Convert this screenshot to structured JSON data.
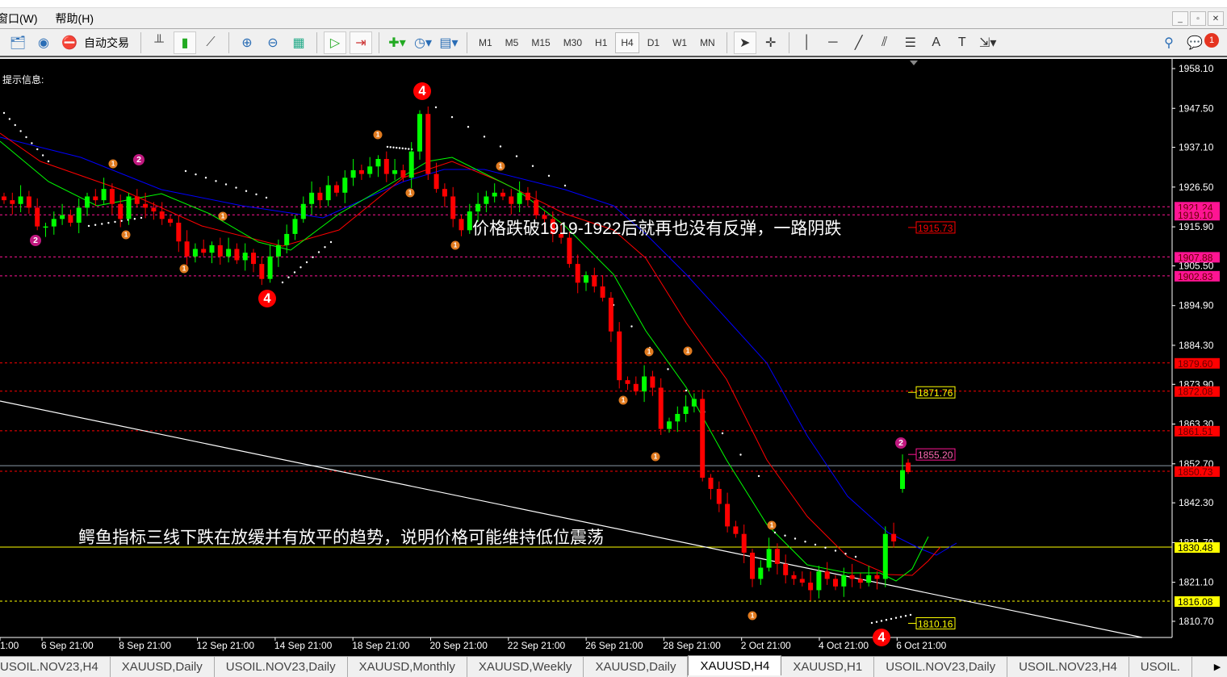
{
  "menu": [
    "窗口(W)",
    "帮助(H)"
  ],
  "window_controls": [
    "_",
    "▫",
    "✕"
  ],
  "toolbar": {
    "auto_trade_label": "自动交易",
    "timeframes": [
      "M1",
      "M5",
      "M15",
      "M30",
      "H1",
      "H4",
      "D1",
      "W1",
      "MN"
    ],
    "active_timeframe": "H4",
    "notification_count": "1"
  },
  "chart": {
    "hint_label": "提示信息:",
    "annotation_top": "价格跌破1919-1922后就再也没有反弹，一路阴跌",
    "annotation_bottom": "鳄鱼指标三线下跌在放缓并有放平的趋势，说明价格可能维持低位震荡",
    "price_axis": [
      "1958.10",
      "1947.50",
      "1937.10",
      "1926.50",
      "1915.90",
      "1905.50",
      "1894.90",
      "1884.30",
      "1873.90",
      "1863.30",
      "1852.70",
      "1842.30",
      "1831.70",
      "1821.10",
      "1810.70"
    ],
    "time_axis": [
      "1:00",
      "6 Sep 21:00",
      "8 Sep 21:00",
      "12 Sep 21:00",
      "14 Sep 21:00",
      "18 Sep 21:00",
      "20 Sep 21:00",
      "22 Sep 21:00",
      "26 Sep 21:00",
      "28 Sep 21:00",
      "2 Oct 21:00",
      "4 Oct 21:00",
      "6 Oct 21:00"
    ],
    "level_tags": [
      {
        "price": 1921.24,
        "label": "1921.24",
        "color": "#ff1493",
        "style": "dashed"
      },
      {
        "price": 1919.1,
        "label": "1919.10",
        "color": "#ff1493",
        "style": "dashed"
      },
      {
        "price": 1907.88,
        "label": "1907.88",
        "color": "#ff1493",
        "style": "dashed"
      },
      {
        "price": 1902.83,
        "label": "1902.83",
        "color": "#ff1493",
        "style": "dashed"
      },
      {
        "price": 1879.6,
        "label": "1879.60",
        "color": "#ff0000",
        "style": "dashed"
      },
      {
        "price": 1872.08,
        "label": "1872.08",
        "color": "#ff0000",
        "style": "dashed"
      },
      {
        "price": 1861.51,
        "label": "1861.51",
        "color": "#ff0000",
        "style": "dashed"
      },
      {
        "price": 1850.73,
        "label": "1850.73",
        "color": "#ff0000",
        "style": "dashed"
      },
      {
        "price": 1830.48,
        "label": "1830.48",
        "color": "#ffff00",
        "style": "solid"
      },
      {
        "price": 1816.08,
        "label": "1816.08",
        "color": "#ffff00",
        "style": "dashed"
      }
    ],
    "price_labels": [
      {
        "price": 1915.73,
        "label": "1915.73",
        "color": "#ff0000"
      },
      {
        "price": 1871.76,
        "label": "1871.76",
        "color": "#ffff00"
      },
      {
        "price": 1855.2,
        "label": "1855.20",
        "color": "#ff1493"
      },
      {
        "price": 1810.16,
        "label": "1810.16",
        "color": "#ffff00"
      }
    ],
    "closes": [
      1923,
      1922,
      1924,
      1921,
      1916,
      1916,
      1918,
      1919,
      1917,
      1921,
      1924,
      1923,
      1926,
      1922,
      1918,
      1924,
      1922,
      1921,
      1920,
      1918,
      1917,
      1912,
      1908,
      1910,
      1909,
      1911,
      1908,
      1910,
      1907,
      1909,
      1906,
      1902,
      1908,
      1911,
      1914,
      1918,
      1922,
      1925,
      1923,
      1927,
      1925,
      1929,
      1931,
      1930,
      1932,
      1934,
      1930,
      1931,
      1929,
      1936,
      1946,
      1930,
      1926,
      1924,
      1918,
      1915,
      1920,
      1922,
      1924,
      1925,
      1924,
      1922,
      1925,
      1923,
      1919,
      1918,
      1914,
      1913,
      1906,
      1901,
      1903,
      1900,
      1897,
      1888,
      1875,
      1874,
      1872,
      1876,
      1873,
      1862,
      1864,
      1866,
      1868,
      1870,
      1849,
      1846,
      1842,
      1836,
      1834,
      1829,
      1822,
      1825,
      1830,
      1826,
      1823,
      1822,
      1821,
      1819,
      1824,
      1822,
      1820,
      1823,
      1822,
      1821,
      1823,
      1822,
      1834,
      1832
    ],
    "last_candles": [
      {
        "open": 1846,
        "close": 1851,
        "high": 1855.2,
        "low": 1845
      },
      {
        "open": 1853,
        "close": 1850.5,
        "high": 1854,
        "low": 1850
      }
    ],
    "markers": [
      {
        "label": "1",
        "color": "#e07a1f"
      },
      {
        "label": "1",
        "color": "#e07a1f"
      },
      {
        "label": "1",
        "color": "#e07a1f"
      },
      {
        "label": "1",
        "color": "#e07a1f"
      },
      {
        "label": "1",
        "color": "#e07a1f"
      },
      {
        "label": "1",
        "color": "#e07a1f"
      },
      {
        "label": "1",
        "color": "#e07a1f"
      },
      {
        "label": "1",
        "color": "#e07a1f"
      },
      {
        "label": "1",
        "color": "#e07a1f"
      },
      {
        "label": "1",
        "color": "#e07a1f"
      },
      {
        "label": "1",
        "color": "#e07a1f"
      },
      {
        "label": "1",
        "color": "#e07a1f"
      },
      {
        "label": "1",
        "color": "#e07a1f"
      },
      {
        "label": "1",
        "color": "#e07a1f"
      },
      {
        "label": "2",
        "color": "#c0187f"
      },
      {
        "label": "2",
        "color": "#c0187f"
      },
      {
        "label": "2",
        "color": "#c0187f"
      },
      {
        "label": "4",
        "color": "#ff0000"
      },
      {
        "label": "4",
        "color": "#ff0000"
      },
      {
        "label": "4",
        "color": "#ff0000"
      }
    ],
    "colors": {
      "bull": "#00ff00",
      "bear": "#ff0000",
      "ma_blue": "#0000ff",
      "ma_red": "#ff0000",
      "ma_green": "#00ff00",
      "trend": "#ffffff"
    }
  },
  "tabs": [
    "USOIL.NOV23,H4",
    "XAUUSD,Daily",
    "USOIL.NOV23,Daily",
    "XAUUSD,Monthly",
    "XAUUSD,Weekly",
    "XAUUSD,Daily",
    "XAUUSD,H4",
    "XAUUSD,H1",
    "USOIL.NOV23,Daily",
    "USOIL.NOV23,H4",
    "USOIL."
  ],
  "active_tab": "XAUUSD,H4"
}
